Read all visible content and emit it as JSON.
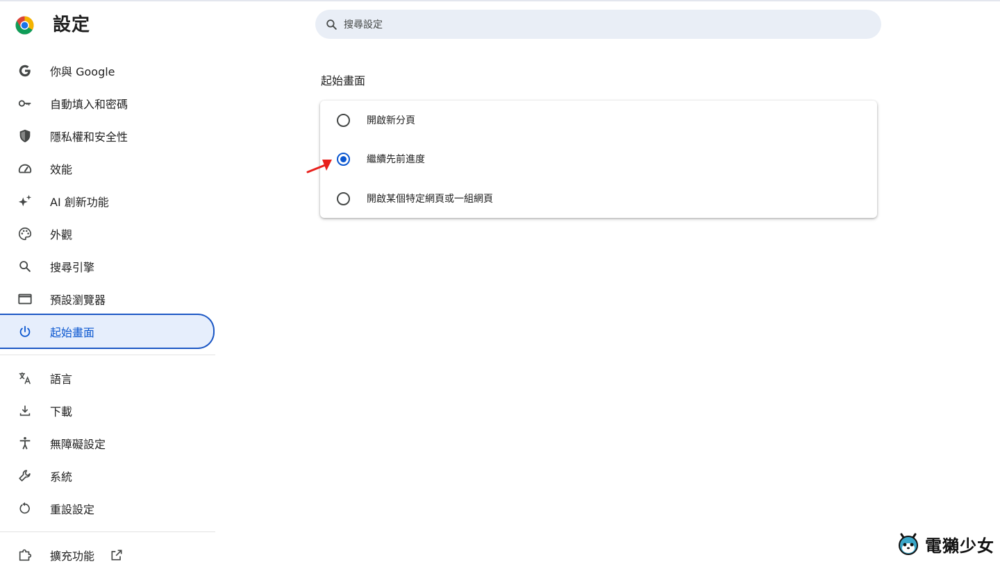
{
  "app": {
    "title": "設定"
  },
  "search": {
    "placeholder": "搜尋設定"
  },
  "sidebar": {
    "items": [
      {
        "label": "你與 Google",
        "icon": "google-g-icon"
      },
      {
        "label": "自動填入和密碼",
        "icon": "key-icon"
      },
      {
        "label": "隱私權和安全性",
        "icon": "shield-icon"
      },
      {
        "label": "效能",
        "icon": "speedometer-icon"
      },
      {
        "label": "AI 創新功能",
        "icon": "sparkle-icon"
      },
      {
        "label": "外觀",
        "icon": "palette-icon"
      },
      {
        "label": "搜尋引擎",
        "icon": "search-icon"
      },
      {
        "label": "預設瀏覽器",
        "icon": "browser-window-icon"
      },
      {
        "label": "起始畫面",
        "icon": "power-icon",
        "active": true
      },
      {
        "label": "語言",
        "icon": "translate-icon"
      },
      {
        "label": "下載",
        "icon": "download-icon"
      },
      {
        "label": "無障礙設定",
        "icon": "accessibility-icon"
      },
      {
        "label": "系統",
        "icon": "wrench-icon"
      },
      {
        "label": "重設設定",
        "icon": "reset-icon"
      },
      {
        "label": "擴充功能",
        "icon": "puzzle-icon"
      }
    ]
  },
  "main": {
    "section_title": "起始畫面",
    "options": [
      {
        "label": "開啟新分頁",
        "selected": false
      },
      {
        "label": "繼續先前進度",
        "selected": true
      },
      {
        "label": "開啟某個特定網頁或一組網頁",
        "selected": false
      }
    ]
  },
  "watermark": {
    "text": "電獺少女"
  },
  "colors": {
    "accent": "#0b57d0",
    "active_bg": "#e6eefc",
    "search_bg": "#e9eef6",
    "arrow": "#e8201c"
  }
}
